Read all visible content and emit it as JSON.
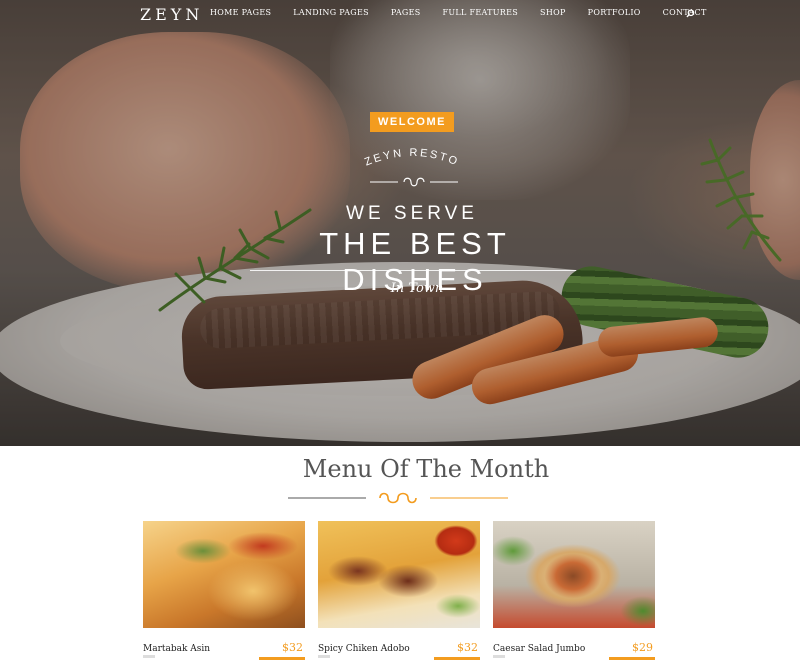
{
  "brand": {
    "logo": "ZEYN"
  },
  "nav": {
    "items": [
      "HOME PAGES",
      "LANDING PAGES",
      "PAGES",
      "FULL FEATURES",
      "SHOP",
      "PORTFOLIO",
      "CONTACT"
    ],
    "search_icon": "search-icon"
  },
  "hero": {
    "badge": "WELCOME",
    "arc_text": "ZEYN RESTO",
    "line1": "WE SERVE",
    "line2": "THE BEST DISHES",
    "line3": "In Town"
  },
  "menu": {
    "title": "Menu Of The Month",
    "items": [
      {
        "name": "Martabak Asin",
        "price": "$32"
      },
      {
        "name": "Spicy Chiken Adobo",
        "price": "$32"
      },
      {
        "name": "Caesar Salad Jumbo",
        "price": "$29"
      }
    ]
  },
  "colors": {
    "accent": "#f39c1f",
    "text_dark": "#222222",
    "title_gray": "#555555"
  }
}
